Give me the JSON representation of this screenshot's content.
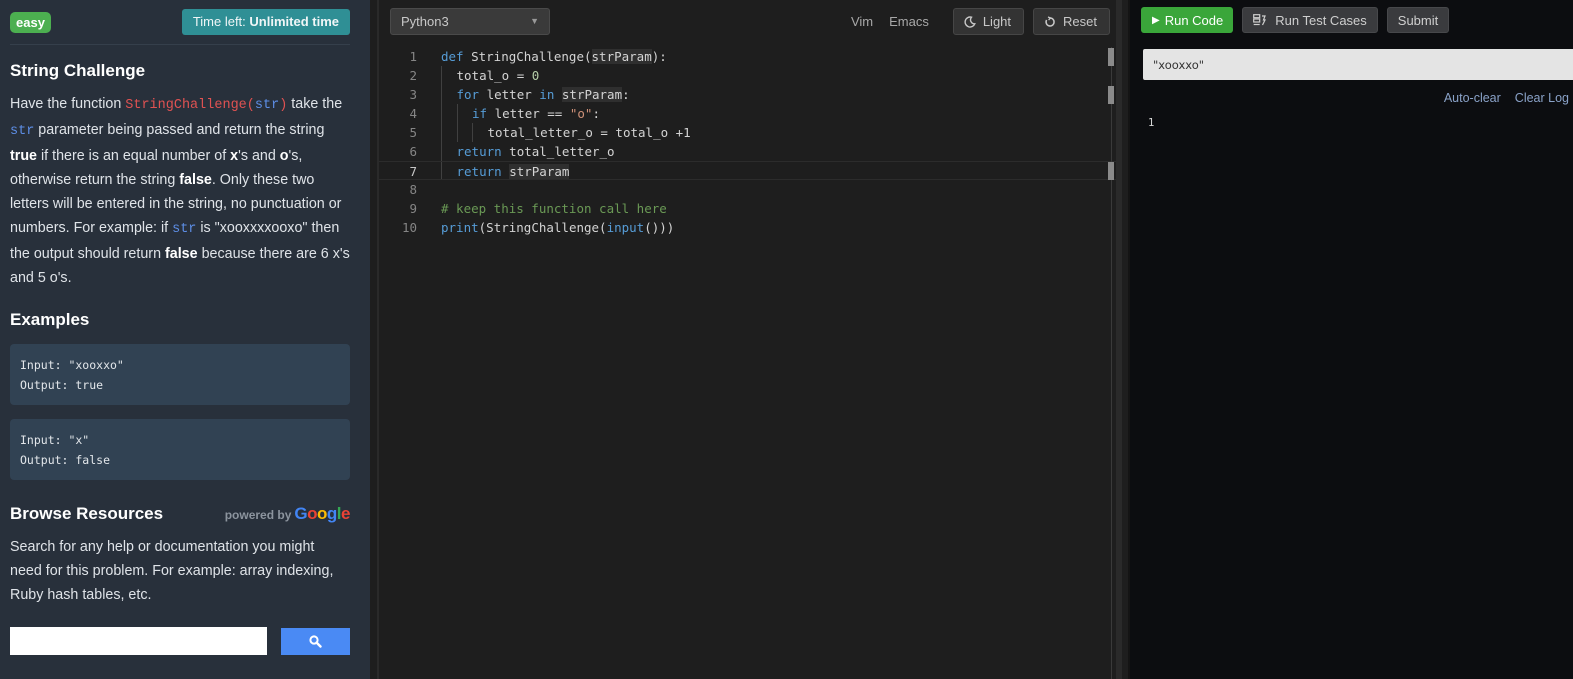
{
  "problem": {
    "difficulty": "easy",
    "time_left_label": "Time left:",
    "time_left_value": "Unlimited time",
    "title": "String Challenge",
    "description": {
      "p1": "Have the function ",
      "fn_code": "StringChallenge",
      "fn_paren_open": "(",
      "fn_arg": "str",
      "fn_paren_close": ")",
      "p2": " take the ",
      "param_code": "str",
      "p3": " parameter being passed and return the string ",
      "b_true": "true",
      "p4": " if there is an equal number of ",
      "b_x": "x",
      "p5": "'s and ",
      "b_o": "o",
      "p6": "'s, otherwise return the string ",
      "b_false": "false",
      "p7": ". Only these two letters will be entered in the string, no punctuation or numbers. For example: if ",
      "param_code2": "str",
      "p8": " is \"xooxxxxooxo\" then the output should return ",
      "b_false2": "false",
      "p9": " because there are 6 x's and 5 o's."
    },
    "examples_title": "Examples",
    "examples": [
      {
        "input": "Input: \"xooxxo\"",
        "output": "Output: true"
      },
      {
        "input": "Input: \"x\"",
        "output": "Output: false"
      }
    ]
  },
  "resources": {
    "title": "Browse Resources",
    "powered_by": "powered by",
    "google": [
      "G",
      "o",
      "o",
      "g",
      "l",
      "e"
    ],
    "google_colors": [
      "#4285f4",
      "#ea4335",
      "#fbbc05",
      "#4285f4",
      "#34a853",
      "#ea4335"
    ],
    "description": "Search for any help or documentation you might need for this problem. For example: array indexing, Ruby hash tables, etc.",
    "search_value": "",
    "search_placeholder": ""
  },
  "editor": {
    "language": "Python3",
    "keymaps": [
      "Vim",
      "Emacs"
    ],
    "theme_button": "Light",
    "reset_button": "Reset",
    "active_line": 7,
    "lines": [
      {
        "n": "1",
        "tokens": [
          [
            "kw",
            "def"
          ],
          [
            "t",
            " StringChallenge("
          ],
          [
            "hl",
            "strParam"
          ],
          [
            "t",
            "):"
          ]
        ],
        "indent": 0
      },
      {
        "n": "2",
        "tokens": [
          [
            "t",
            "total_o = "
          ],
          [
            "num",
            "0"
          ]
        ],
        "indent": 1
      },
      {
        "n": "3",
        "tokens": [
          [
            "kw",
            "for"
          ],
          [
            "t",
            " letter "
          ],
          [
            "kw",
            "in"
          ],
          [
            "t",
            " "
          ],
          [
            "hl",
            "strParam"
          ],
          [
            "t",
            ":"
          ]
        ],
        "indent": 1
      },
      {
        "n": "4",
        "tokens": [
          [
            "kw",
            "if"
          ],
          [
            "t",
            " letter == "
          ],
          [
            "str",
            "\"o\""
          ],
          [
            "t",
            ":"
          ]
        ],
        "indent": 2
      },
      {
        "n": "5",
        "tokens": [
          [
            "t",
            "total_letter_o = total_o +1"
          ]
        ],
        "indent": 3
      },
      {
        "n": "6",
        "tokens": [
          [
            "kw",
            "return"
          ],
          [
            "t",
            " total_letter_o"
          ]
        ],
        "indent": 1
      },
      {
        "n": "7",
        "tokens": [
          [
            "kw",
            "return"
          ],
          [
            "t",
            " "
          ],
          [
            "hl",
            "strParam"
          ]
        ],
        "indent": 1
      },
      {
        "n": "8",
        "tokens": [],
        "indent": 0
      },
      {
        "n": "9",
        "tokens": [
          [
            "cm",
            "# keep this function call here"
          ]
        ],
        "indent": 0
      },
      {
        "n": "10",
        "tokens": [
          [
            "bi",
            "print"
          ],
          [
            "t",
            "(StringChallenge("
          ],
          [
            "bi",
            "input"
          ],
          [
            "t",
            "()))"
          ]
        ],
        "indent": 0
      }
    ]
  },
  "console": {
    "run_code": "Run Code",
    "run_tests": "Run Test Cases",
    "submit": "Submit",
    "input_value": "\"xooxxo\"",
    "auto_clear": "Auto-clear",
    "clear_log": "Clear Log",
    "output": "1"
  },
  "colors": {
    "easy_badge": "#4caf50",
    "time_badge": "#2f8f95",
    "run_button": "#3aa63a",
    "search_button": "#4a8af4"
  }
}
